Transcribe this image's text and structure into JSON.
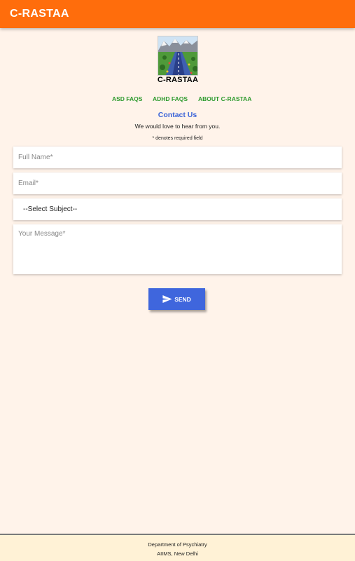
{
  "appbar": {
    "title": "C-RASTAA"
  },
  "logo": {
    "text": "C-RASTAA"
  },
  "nav": {
    "asd": "ASD FAQS",
    "adhd": "ADHD FAQS",
    "about": "ABOUT C-RASTAA"
  },
  "contact": {
    "title": "Contact Us",
    "subtitle": "We would love to hear from you.",
    "required_note": "* denotes required field"
  },
  "form": {
    "name_placeholder": "Full Name*",
    "email_placeholder": "Email*",
    "subject_selected": "--Select Subject--",
    "message_placeholder": "Your Message*",
    "send_label": "SEND"
  },
  "footer": {
    "line1": "Department of Psychiatry",
    "line2": "AIIMS, New Delhi"
  },
  "colors": {
    "appbar": "#ff6d0c",
    "background": "#fff3ea",
    "nav_link": "#2e9a2e",
    "contact_title": "#3a63d8",
    "send_button": "#3f66dd",
    "footer_bg": "#fff2d6"
  },
  "icons": {
    "send": "send-icon"
  }
}
